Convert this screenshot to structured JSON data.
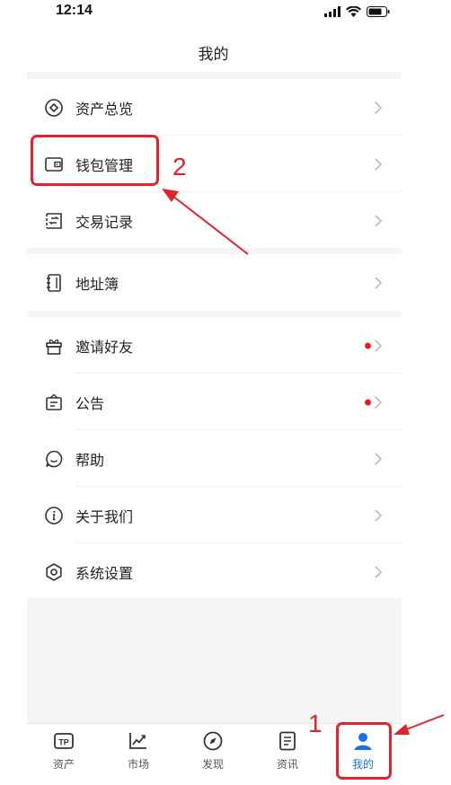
{
  "status_bar": {
    "time": "12:14"
  },
  "page": {
    "title": "我的"
  },
  "menu": {
    "group1": [
      {
        "label": "资产总览",
        "icon": "asset-overview-icon"
      },
      {
        "label": "钱包管理",
        "icon": "wallet-icon"
      },
      {
        "label": "交易记录",
        "icon": "transaction-record-icon"
      }
    ],
    "group2": [
      {
        "label": "地址簿",
        "icon": "address-book-icon"
      }
    ],
    "group3": [
      {
        "label": "邀请好友",
        "icon": "gift-icon",
        "badge": true
      },
      {
        "label": "公告",
        "icon": "announcement-icon",
        "badge": true
      },
      {
        "label": "帮助",
        "icon": "help-icon"
      },
      {
        "label": "关于我们",
        "icon": "info-icon"
      },
      {
        "label": "系统设置",
        "icon": "settings-icon"
      }
    ]
  },
  "tabbar": {
    "tabs": [
      {
        "label": "资产",
        "icon": "tp-wallet-icon"
      },
      {
        "label": "市场",
        "icon": "market-chart-icon"
      },
      {
        "label": "发现",
        "icon": "compass-icon"
      },
      {
        "label": "资讯",
        "icon": "news-icon"
      },
      {
        "label": "我的",
        "icon": "person-icon",
        "active": true
      }
    ]
  },
  "annotations": {
    "step1": "1",
    "step2": "2"
  },
  "colors": {
    "accent": "#1a6ff0",
    "annotation": "#e0242a",
    "badge": "#e02020",
    "background": "#f5f5f5"
  }
}
